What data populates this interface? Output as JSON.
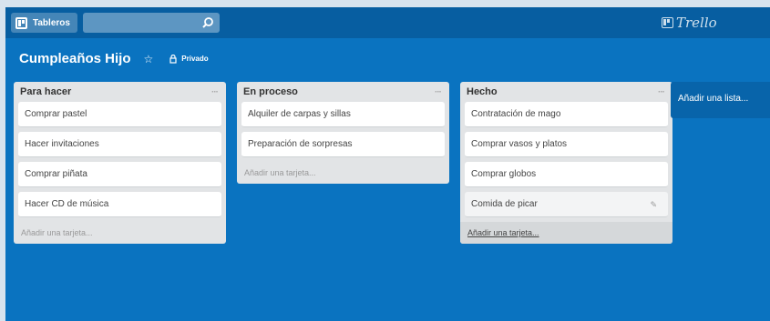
{
  "header": {
    "boards_label": "Tableros",
    "search_placeholder": "",
    "logo_text": "Trello"
  },
  "board": {
    "title": "Cumpleaños Hijo",
    "privacy_label": "Privado"
  },
  "lists": [
    {
      "title": "Para hacer",
      "menu": "···",
      "cards": [
        "Comprar pastel",
        "Hacer invitaciones",
        "Comprar piñata",
        "Hacer CD de música"
      ],
      "add_card": "Añadir una tarjeta..."
    },
    {
      "title": "En proceso",
      "menu": "···",
      "cards": [
        "Alquiler de carpas y sillas",
        "Preparación de sorpresas"
      ],
      "add_card": "Añadir una tarjeta..."
    },
    {
      "title": "Hecho",
      "menu": "···",
      "cards": [
        "Contratación de mago",
        "Comprar vasos y platos",
        "Comprar globos",
        "Comida de picar"
      ],
      "add_card": "Añadir una tarjeta..."
    }
  ],
  "add_list_label": "Añadir una lista...",
  "colors": {
    "board_background": "#0a73c0",
    "header_background": "#075ea1",
    "list_background": "#e2e4e6"
  },
  "icons": {
    "boards": "boards-icon",
    "search": "search-icon",
    "star": "star-icon",
    "privacy": "lock-icon",
    "edit": "pencil-icon"
  }
}
